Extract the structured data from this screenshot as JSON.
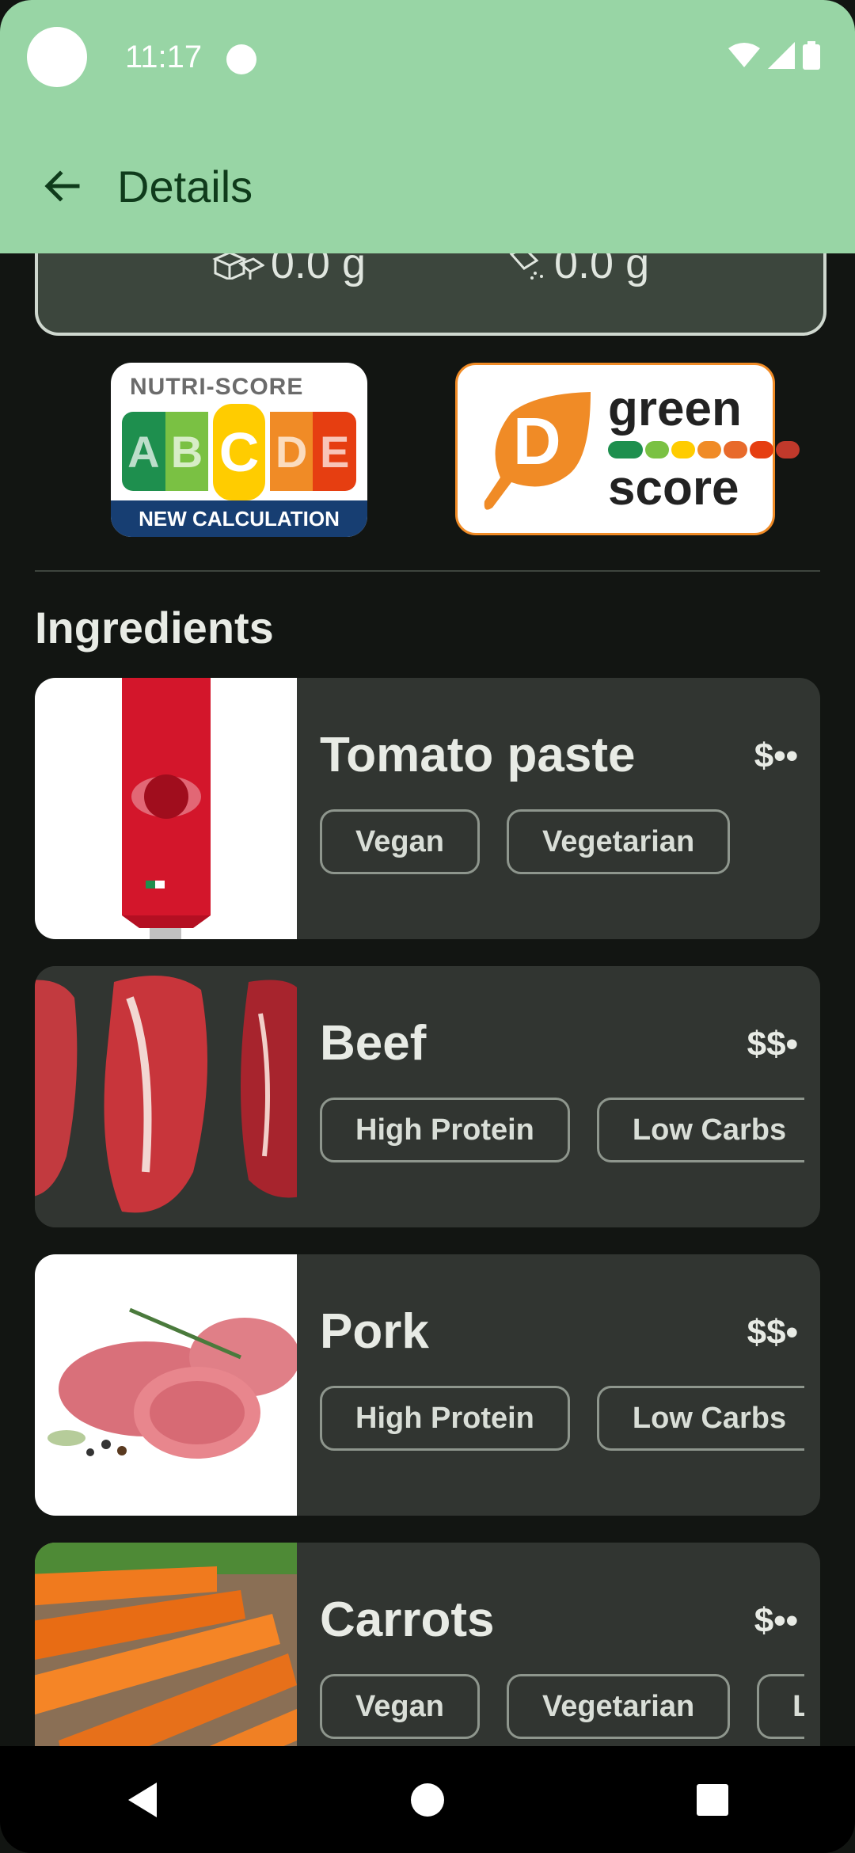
{
  "status_bar": {
    "time": "11:17"
  },
  "app_bar": {
    "title": "Details"
  },
  "nutrition": {
    "value_left": "0.0 g",
    "value_right": "0.0 g"
  },
  "nutri_score": {
    "label": "NUTRI-SCORE",
    "grades": [
      "A",
      "B",
      "C",
      "D",
      "E"
    ],
    "active_grade": "C",
    "footer": "NEW CALCULATION",
    "colors": [
      "#1e8f4e",
      "#7ac143",
      "#ffcc00",
      "#f08b26",
      "#e63e11"
    ]
  },
  "green_score": {
    "grade": "D",
    "word_top": "green",
    "word_bottom": "score",
    "colors": [
      "#1e8f4e",
      "#7ac143",
      "#ffcc00",
      "#f08b26",
      "#e86a2b",
      "#e63e11",
      "#c0392b"
    ]
  },
  "section": {
    "title": "Ingredients"
  },
  "ingredients": [
    {
      "name": "Tomato paste",
      "price": "$••",
      "tags": [
        "Vegan",
        "Vegetarian"
      ]
    },
    {
      "name": "Beef",
      "price": "$$•",
      "tags": [
        "High Protein",
        "Low Carbs"
      ]
    },
    {
      "name": "Pork",
      "price": "$$•",
      "tags": [
        "High Protein",
        "Low Carbs"
      ]
    },
    {
      "name": "Carrots",
      "price": "$••",
      "tags": [
        "Vegan",
        "Vegetarian",
        "L"
      ]
    }
  ]
}
